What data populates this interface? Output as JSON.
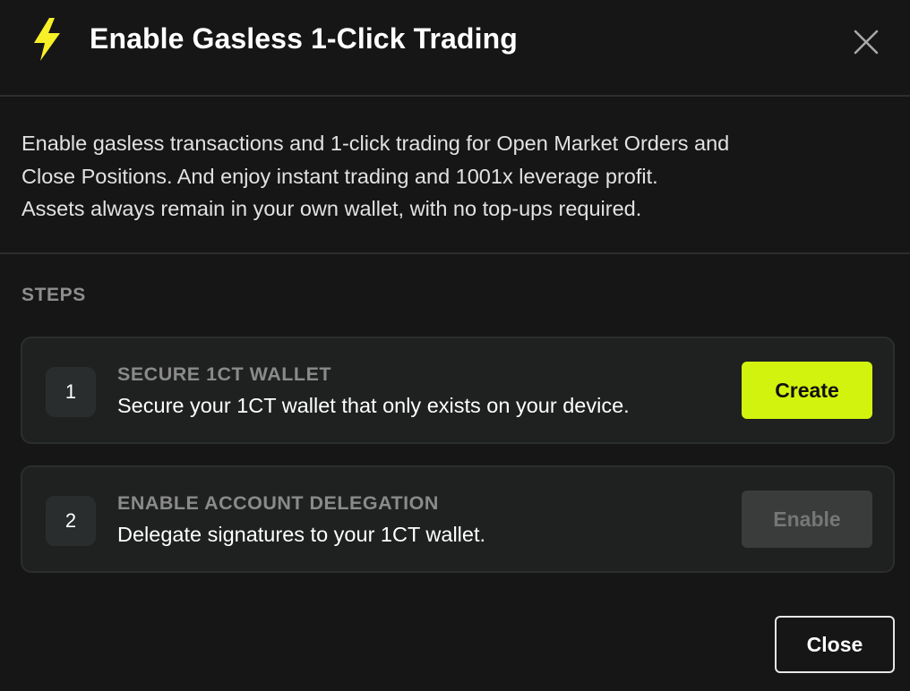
{
  "dialog": {
    "title": "Enable Gasless 1-Click Trading",
    "title_icon": "lightning-bolt-icon",
    "close_icon": "close-icon"
  },
  "description": {
    "lines": [
      "Enable gasless transactions and 1-click trading for Open Market Orders and",
      "Close Positions. And enjoy instant trading and 1001x leverage profit.",
      "Assets always remain in your own wallet, with no top-ups required."
    ]
  },
  "steps": {
    "heading": "STEPS",
    "items": [
      {
        "number": "1",
        "title": "SECURE 1CT WALLET",
        "description": "Secure your 1CT wallet that only exists on your device.",
        "button_label": "Create",
        "button_enabled": true
      },
      {
        "number": "2",
        "title": "ENABLE ACCOUNT DELEGATION",
        "description": "Delegate signatures to your 1CT wallet.",
        "button_label": "Enable",
        "button_enabled": false
      }
    ]
  },
  "footer": {
    "close_label": "Close"
  },
  "colors": {
    "background": "#161616",
    "accent": "#d2f30e",
    "bolt": "#f7f028",
    "card": "#1f2020",
    "divider": "#2e2e2e",
    "muted_text": "#8a8a8a"
  }
}
